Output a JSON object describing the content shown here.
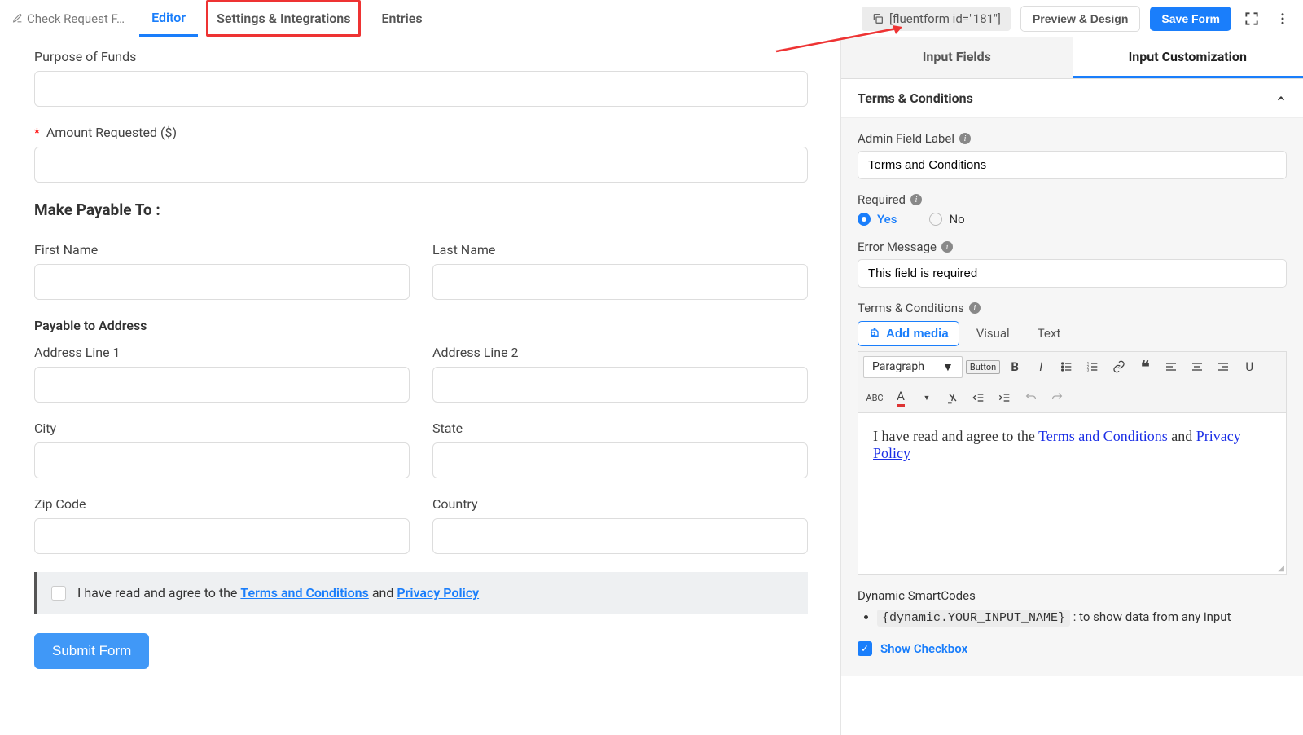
{
  "topbar": {
    "form_name": "Check Request F…",
    "tabs": {
      "editor": "Editor",
      "settings": "Settings & Integrations",
      "entries": "Entries"
    },
    "shortcode": "[fluentform id=\"181\"]",
    "preview": "Preview & Design",
    "save": "Save Form"
  },
  "form": {
    "purpose_label": "Purpose of Funds",
    "amount_label": "Amount Requested ($)",
    "payable_heading": "Make Payable To :",
    "first_name": "First Name",
    "last_name": "Last Name",
    "payable_address": "Payable to Address",
    "addr1": "Address Line 1",
    "addr2": "Address Line 2",
    "city": "City",
    "state": "State",
    "zip": "Zip Code",
    "country": "Country",
    "tc_prefix": "I have read and agree to the ",
    "tc_link1": "Terms and Conditions",
    "tc_mid": " and ",
    "tc_link2": "Privacy Policy",
    "submit": "Submit Form"
  },
  "sidebar": {
    "tab_fields": "Input Fields",
    "tab_custom": "Input Customization",
    "panel_title": "Terms & Conditions",
    "admin_label": "Admin Field Label",
    "admin_label_value": "Terms and Conditions",
    "required": "Required",
    "yes": "Yes",
    "no": "No",
    "error_label": "Error Message",
    "error_value": "This field is required",
    "tc_label": "Terms & Conditions",
    "add_media": "Add media",
    "visual": "Visual",
    "text": "Text",
    "paragraph": "Paragraph",
    "button_badge": "Button",
    "wysiwyg_prefix": "I have read and agree to the ",
    "wysiwyg_link1": "Terms and Conditions",
    "wysiwyg_mid": " and ",
    "wysiwyg_link2": "Privacy Policy",
    "smartcodes_title": "Dynamic SmartCodes",
    "smartcode_pill": "{dynamic.YOUR_INPUT_NAME}",
    "smartcode_desc": " : to show data from any input",
    "showcb": "Show Checkbox"
  }
}
